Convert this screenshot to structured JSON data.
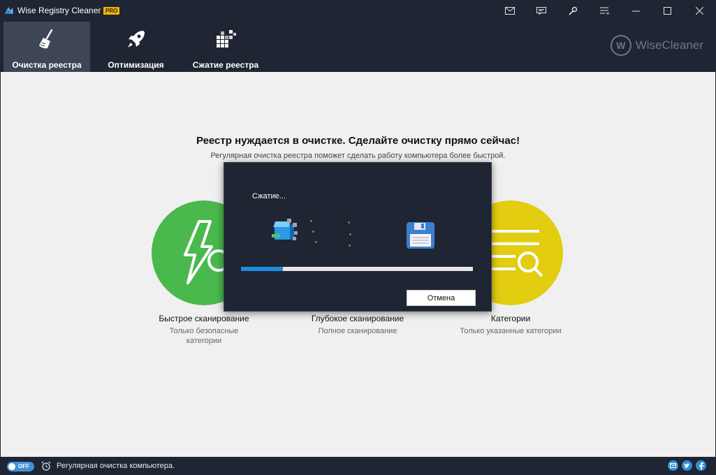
{
  "window": {
    "title": "Wise Registry Cleaner X",
    "badge": "PRO",
    "buttons": [
      "mail-icon",
      "feedback-icon",
      "settings-icon",
      "menu-icon",
      "minimize-icon",
      "maximize-icon",
      "close-icon"
    ]
  },
  "nav": {
    "tabs": [
      {
        "label": "Очистка реестра",
        "icon": "broom-icon",
        "active": true
      },
      {
        "label": "Оптимизация",
        "icon": "rocket-icon",
        "active": false
      },
      {
        "label": "Сжатие реестра",
        "icon": "defrag-icon",
        "active": false
      }
    ],
    "brand": {
      "mark": "W",
      "name": "WiseCleaner"
    }
  },
  "main": {
    "headline": "Реестр нуждается в очистке. Сделайте очистку прямо сейчас!",
    "subline": "Регулярная очистка реестра поможет сделать работу компьютера более быстрой.",
    "scans": [
      {
        "title": "Быстрое сканирование",
        "desc1": "Только безопасные",
        "desc2": "категории",
        "color": "#49b94d"
      },
      {
        "title": "Глубокое сканирование",
        "desc1": "Полное сканирование",
        "desc2": ""
      },
      {
        "title": "Категории",
        "desc1": "Только указанные категории",
        "desc2": "",
        "color": "#e2cd10"
      }
    ]
  },
  "dialog": {
    "status": "Сжатие...",
    "progress": 0.18,
    "cancel_label": "Отмена",
    "accent": "#1d8ce0"
  },
  "statusbar": {
    "toggle_label": "OFF",
    "text": "Регулярная очистка компьютера.",
    "social": [
      "email-icon",
      "twitter-icon",
      "facebook-icon"
    ]
  }
}
